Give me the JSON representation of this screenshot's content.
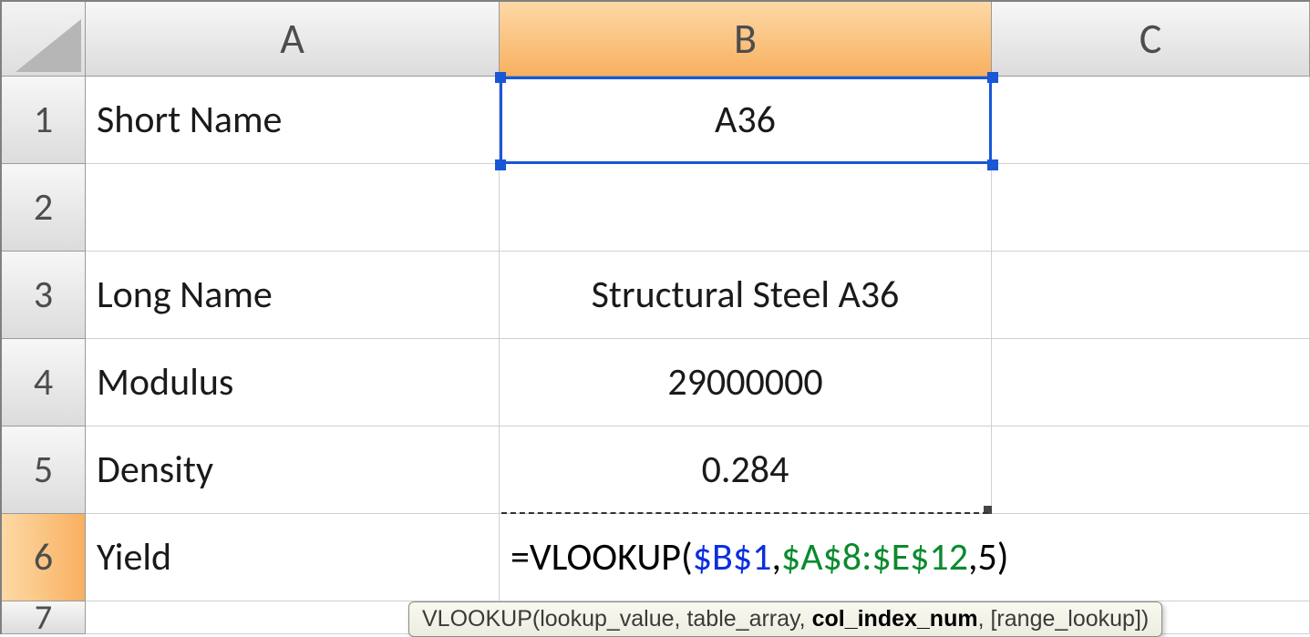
{
  "columns": {
    "A": "A",
    "B": "B",
    "C": "C"
  },
  "row_labels": [
    "1",
    "2",
    "3",
    "4",
    "5",
    "6",
    "7"
  ],
  "cells": {
    "A1": "Short Name",
    "B1": "A36",
    "A3": "Long Name",
    "B3": "Structural Steel A36",
    "A4": "Modulus",
    "B4": "29000000",
    "A5": "Density",
    "B5": "0.284",
    "A6": "Yield"
  },
  "formula": {
    "prefix": "=VLOOKUP(",
    "arg1": "$B$1",
    "sep1": ",",
    "arg2": "$A$8:$E$12",
    "sep2": ",",
    "arg3": "5",
    "suffix": ")"
  },
  "tooltip": {
    "fn": "VLOOKUP",
    "open": "(",
    "p1": "lookup_value",
    "p2": "table_array",
    "p3": "col_index_num",
    "p4": "[range_lookup]",
    "comma": ", ",
    "close": ")"
  }
}
